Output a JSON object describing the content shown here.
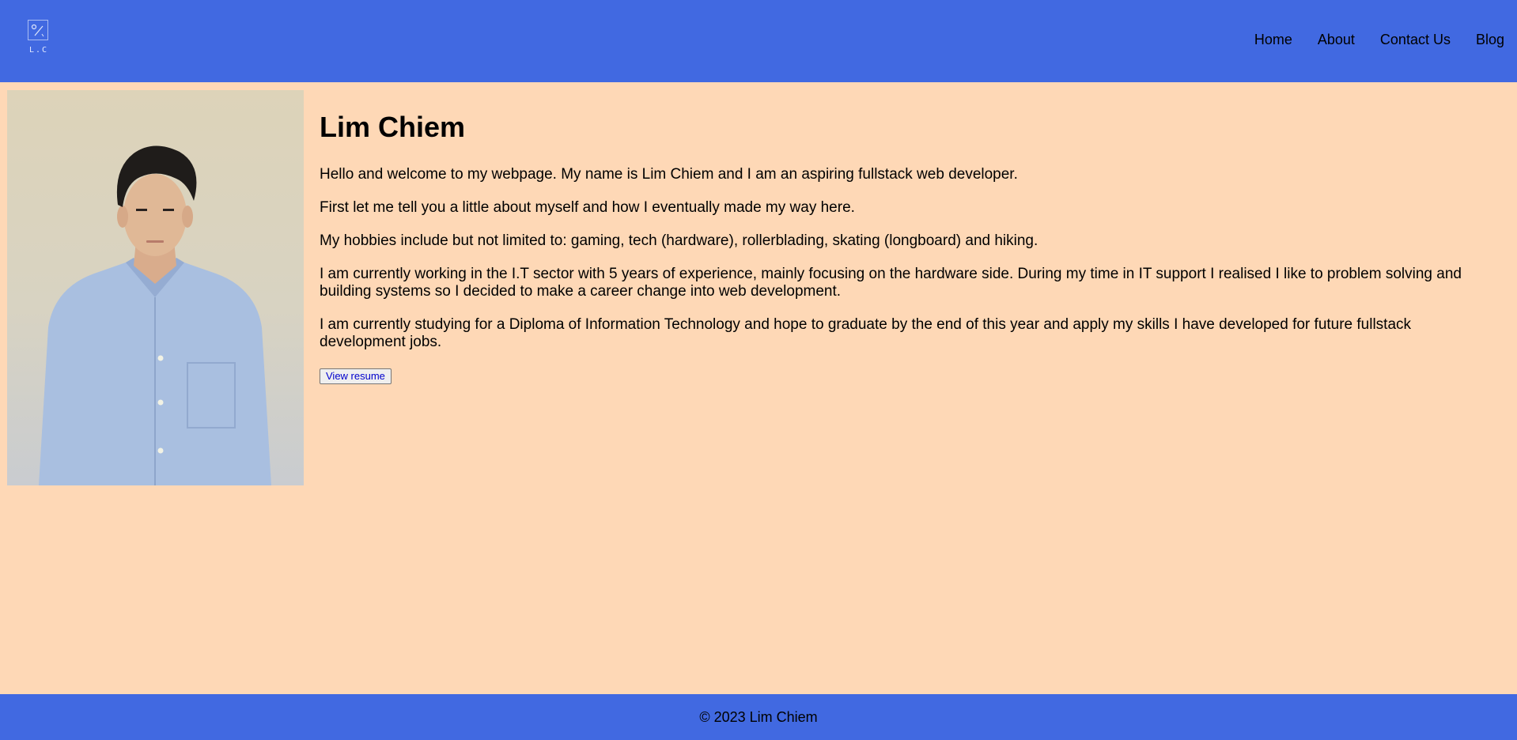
{
  "header": {
    "logo_text": "L.C",
    "nav": [
      "Home",
      "About",
      "Contact Us",
      "Blog"
    ]
  },
  "profile": {
    "name": "Lim Chiem",
    "paragraphs": [
      "Hello and welcome to my webpage. My name is Lim Chiem and I am an aspiring fullstack web developer.",
      "First let me tell you a little about myself and how I eventually made my way here.",
      "My hobbies include but not limited to: gaming, tech (hardware), rollerblading, skating (longboard) and hiking.",
      "I am currently working in the I.T sector with 5 years of experience, mainly focusing on the hardware side. During my time in IT support I realised I like to problem solving and building systems so I decided to make a career change into web development.",
      "I am currently studying for a Diploma of Information Technology and hope to graduate by the end of this year and apply my skills I have developed for future fullstack development jobs."
    ],
    "button_label": "View resume"
  },
  "footer": {
    "text": "© 2023 Lim Chiem"
  },
  "colors": {
    "header_bg": "#4169e1",
    "page_bg": "#fed8b6",
    "shirt": "#a9bfe0",
    "hair": "#1f1c1a"
  },
  "icons": {
    "logo": "broken-image-icon"
  }
}
